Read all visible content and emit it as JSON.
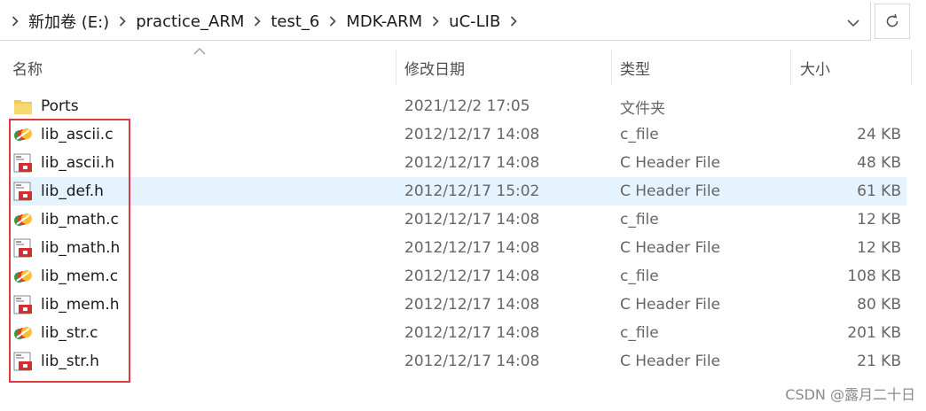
{
  "breadcrumb": {
    "items": [
      "新加卷 (E:)",
      "practice_ARM",
      "test_6",
      "MDK-ARM",
      "uC-LIB"
    ]
  },
  "icons": {
    "dropdown": "chevron-down-icon",
    "refresh": "refresh-icon",
    "folder": "folder-icon",
    "c_file": "c-file-icon",
    "h_file": "header-file-icon"
  },
  "columns": {
    "name": "名称",
    "date": "修改日期",
    "type": "类型",
    "size": "大小"
  },
  "files": [
    {
      "name": "Ports",
      "date": "2021/12/2 17:05",
      "type": "文件夹",
      "size": "",
      "kind": "folder"
    },
    {
      "name": "lib_ascii.c",
      "date": "2012/12/17 14:08",
      "type": "c_file",
      "size": "24 KB",
      "kind": "c"
    },
    {
      "name": "lib_ascii.h",
      "date": "2012/12/17 14:08",
      "type": "C Header File",
      "size": "48 KB",
      "kind": "h"
    },
    {
      "name": "lib_def.h",
      "date": "2012/12/17 15:02",
      "type": "C Header File",
      "size": "61 KB",
      "kind": "h",
      "selected": true
    },
    {
      "name": "lib_math.c",
      "date": "2012/12/17 14:08",
      "type": "c_file",
      "size": "12 KB",
      "kind": "c"
    },
    {
      "name": "lib_math.h",
      "date": "2012/12/17 14:08",
      "type": "C Header File",
      "size": "12 KB",
      "kind": "h"
    },
    {
      "name": "lib_mem.c",
      "date": "2012/12/17 14:08",
      "type": "c_file",
      "size": "108 KB",
      "kind": "c"
    },
    {
      "name": "lib_mem.h",
      "date": "2012/12/17 14:08",
      "type": "C Header File",
      "size": "80 KB",
      "kind": "h"
    },
    {
      "name": "lib_str.c",
      "date": "2012/12/17 14:08",
      "type": "c_file",
      "size": "201 KB",
      "kind": "c"
    },
    {
      "name": "lib_str.h",
      "date": "2012/12/17 14:08",
      "type": "C Header File",
      "size": "21 KB",
      "kind": "h"
    }
  ],
  "colors": {
    "selected_row": "#e5f3ff",
    "highlight_border": "#e0393e",
    "folder": "#f2c94c"
  },
  "watermark": "CSDN @露月二十日"
}
